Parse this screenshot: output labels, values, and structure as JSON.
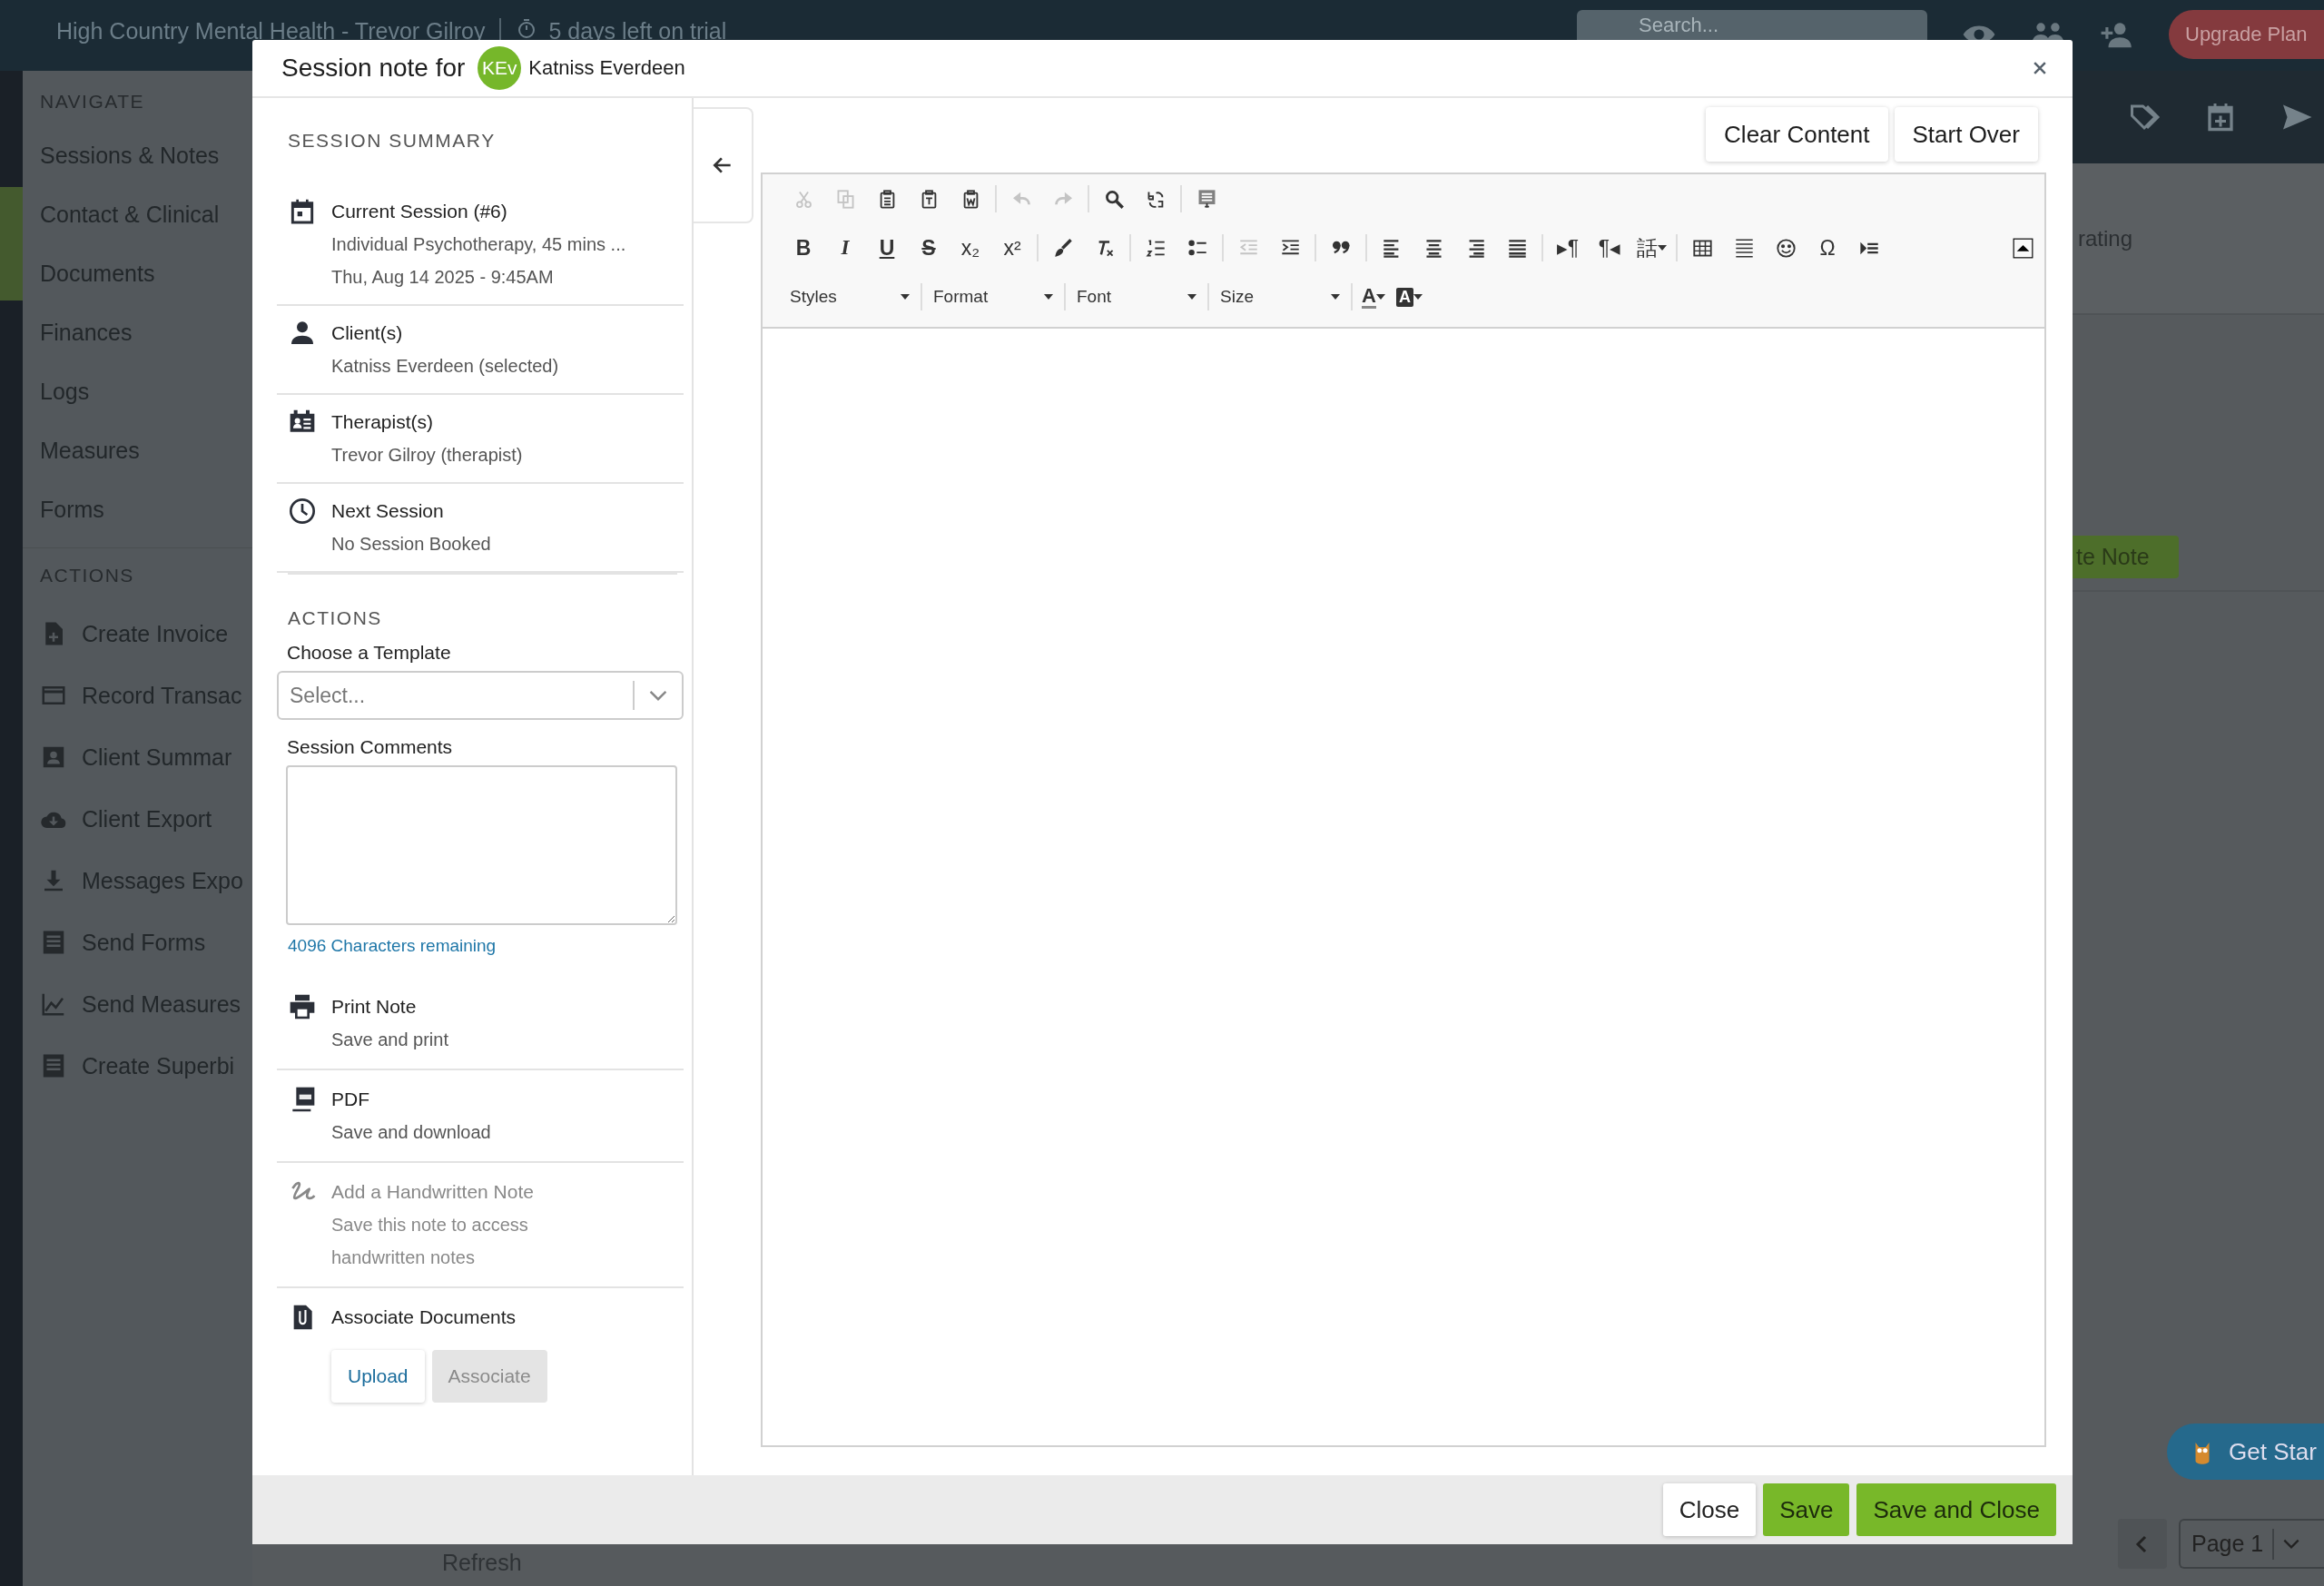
{
  "top_bar": {
    "title": "High Country Mental Health - Trevor Gilroy",
    "trial": "5 days left on trial",
    "search": {
      "placeholder": "Search..."
    },
    "upgrade_button": "Upgrade Plan"
  },
  "sidebar": {
    "navigate_heading": "NAVIGATE",
    "navigate_items": [
      "Sessions & Notes",
      "Contact & Clinical",
      "Documents",
      "Finances",
      "Logs",
      "Measures",
      "Forms"
    ],
    "actions_heading": "ACTIONS",
    "action_items": [
      "Create Invoice",
      "Record Transac",
      "Client Summar",
      "Client Export",
      "Messages Expo",
      "Send Forms",
      "Send Measures",
      "Create Superbi"
    ]
  },
  "main": {
    "table": {
      "columns": [
        "rating"
      ]
    },
    "note_button": "te Note",
    "refresh": "Refresh",
    "pagination": {
      "page": "Page 1"
    },
    "help_widget": "Get Star"
  },
  "modal": {
    "title": "Session note for",
    "client_initials": "KEv",
    "client_name": "Katniss Everdeen",
    "summary_heading": "SESSION SUMMARY",
    "summary_items": [
      {
        "title": "Current Session (#6)",
        "lines": [
          "Individual Psychotherapy, 45 mins ...",
          "Thu, Aug 14 2025 - 9:45AM"
        ]
      },
      {
        "title": "Client(s)",
        "lines": [
          "Katniss Everdeen (selected)"
        ]
      },
      {
        "title": "Therapist(s)",
        "lines": [
          "Trevor Gilroy (therapist)"
        ]
      },
      {
        "title": "Next Session",
        "lines": [
          "No Session Booked"
        ]
      }
    ],
    "actions_heading": "ACTIONS",
    "template": {
      "label": "Choose a Template",
      "placeholder": "Select..."
    },
    "comments": {
      "label": "Session Comments",
      "remaining": "4096 Characters remaining"
    },
    "note_actions": [
      {
        "title": "Print Note",
        "lines": [
          "Save and print"
        ],
        "disabled": false
      },
      {
        "title": "PDF",
        "lines": [
          "Save and download"
        ],
        "disabled": false
      },
      {
        "title": "Add a Handwritten Note",
        "lines": [
          "Save this note to access",
          "handwritten notes"
        ],
        "disabled": true
      },
      {
        "title": "Associate Documents",
        "disabled": false
      }
    ],
    "associate_buttons": [
      {
        "label": "Upload",
        "disabled": false
      },
      {
        "label": "Associate",
        "disabled": true
      }
    ],
    "editor_buttons": [
      "Clear Content",
      "Start Over"
    ],
    "toolbar": [
      [
        [
          {
            "disabled": true
          },
          {
            "disabled": true
          },
          {
            "disabled": false
          },
          {
            "disabled": false
          },
          {
            "disabled": false
          }
        ],
        [
          {
            "disabled": true
          },
          {
            "disabled": true
          }
        ],
        [
          {
            "disabled": false
          },
          {
            "disabled": false
          }
        ],
        [
          {
            "disabled": false
          }
        ]
      ],
      [
        [
          {
            "text": "B",
            "disabled": false
          },
          {
            "text": "I",
            "disabled": false
          },
          {
            "text": "U",
            "disabled": false
          },
          {
            "text": "S",
            "disabled": false
          },
          {
            "text": "x₂",
            "disabled": false
          },
          {
            "text": "x²",
            "disabled": false
          }
        ],
        [
          {
            "disabled": false
          },
          {
            "disabled": false
          }
        ],
        [
          {
            "disabled": false
          },
          {
            "disabled": false
          }
        ],
        [
          {
            "disabled": true
          },
          {
            "disabled": false
          }
        ],
        [
          {
            "disabled": false
          }
        ],
        [
          {
            "disabled": false
          },
          {
            "disabled": false
          },
          {
            "disabled": false
          },
          {
            "disabled": false
          }
        ],
        [
          {
            "text": "▸¶",
            "disabled": false
          },
          {
            "text": "¶◂",
            "disabled": false
          },
          {
            "text": "話",
            "disabled": false
          }
        ],
        [
          {
            "disabled": false
          },
          {
            "disabled": false
          },
          {
            "disabled": false
          },
          {
            "text": "Ω",
            "disabled": false
          },
          {
            "disabled": false
          }
        ]
      ]
    ],
    "combos": [
      "Styles",
      "Format",
      "Font",
      "Size"
    ],
    "color_buttons": [
      {
        "text": "A",
        "kind": "text-color"
      },
      {
        "text": "A",
        "kind": "background-color"
      }
    ],
    "footer_buttons": [
      {
        "label": "Close",
        "kind": "secondary"
      },
      {
        "label": "Save",
        "kind": "primary"
      },
      {
        "label": "Save and Close",
        "kind": "primary"
      }
    ]
  }
}
